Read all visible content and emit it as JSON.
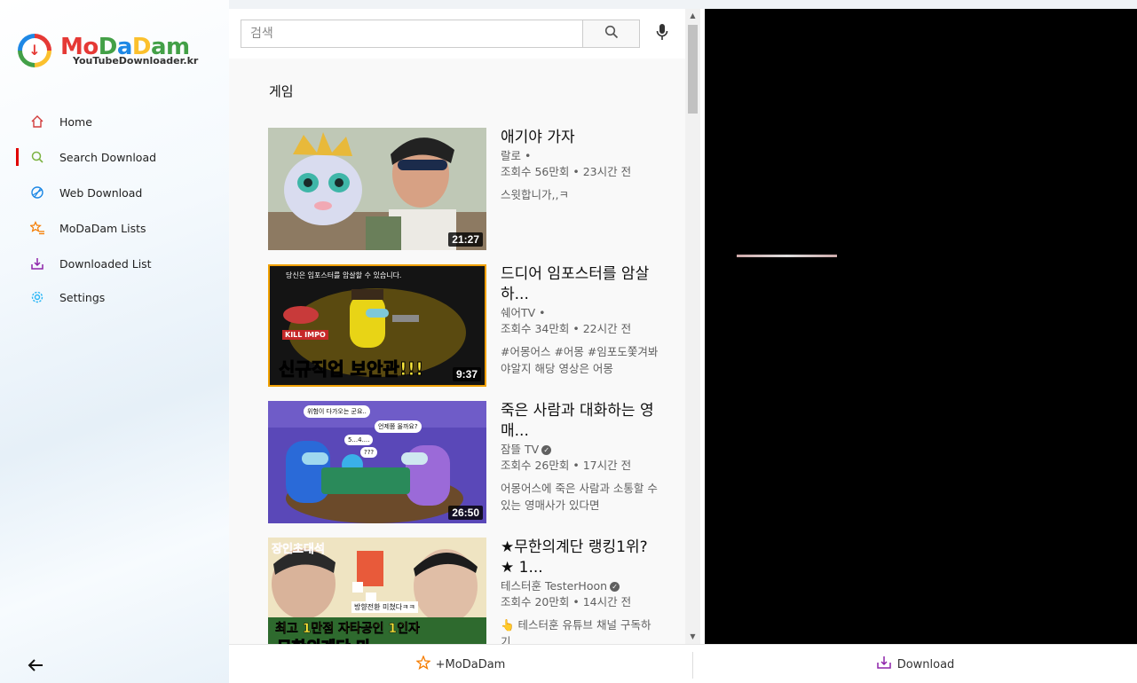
{
  "logo": {
    "title_parts": [
      "Mo",
      "D",
      "a",
      "D",
      "am"
    ],
    "subtitle": "YouTubeDownloader.kr"
  },
  "sidebar": {
    "items": [
      {
        "label": "Home",
        "icon": "home-icon",
        "active": false
      },
      {
        "label": "Search Download",
        "icon": "search-icon",
        "active": true
      },
      {
        "label": "Web Download",
        "icon": "globe-icon",
        "active": false
      },
      {
        "label": "MoDaDam Lists",
        "icon": "star-list-icon",
        "active": false
      },
      {
        "label": "Downloaded List",
        "icon": "download-tray-icon",
        "active": false
      },
      {
        "label": "Settings",
        "icon": "gear-icon",
        "active": false
      }
    ]
  },
  "search": {
    "placeholder": "검색"
  },
  "section": {
    "title": "게임"
  },
  "videos": [
    {
      "title": "애기야 가자",
      "channel": "랄로 •",
      "meta": "조회수 56만회 • 23시간 전",
      "desc": "스윗합니가,,ㅋ",
      "duration": "21:27",
      "verified": false
    },
    {
      "title": "드디어 임포스터를 암살하...",
      "channel": "쉐어TV •",
      "meta": "조회수 34만회 • 22시간 전",
      "desc": "#어몽어스 #어몽 #임포도쫓겨봐야알지 해당 영상은 어몽",
      "duration": "9:37",
      "verified": false,
      "thumb_top_text": "당신은 임포스터를 암살할 수 있습니다.",
      "thumb_big_text": "신규직업 보안관!!!",
      "thumb_tag": "KILL IMPO"
    },
    {
      "title": "죽은 사람과 대화하는 영매...",
      "channel": "잠뜰 TV",
      "meta": "조회수 26만회 • 17시간 전",
      "desc": "어몽어스에 죽은 사람과 소통할 수 있는 영매사가 있다면",
      "duration": "26:50",
      "verified": true,
      "thumb_bubbles": [
        "위험이 다가오는 군요..",
        "언제쯤 올까요?",
        "5...4....",
        "???"
      ]
    },
    {
      "title": "★무한의계단 랭킹1위?★ 1...",
      "channel": "테스터훈 TesterHoon",
      "meta": "조회수 20만회 • 14시간 전",
      "desc": "👆 테스터훈 유튜브 채널 구독하기",
      "duration": "",
      "verified": true,
      "thumb_top_text": "장인초대석",
      "thumb_mid_text": "방향전환 미쳤다ㅋㅋ",
      "thumb_big_text": "최고 1만점 자타공인 1인자",
      "thumb_bottom_text": "무한의계단 마"
    }
  ],
  "bottom": {
    "add_label": "+MoDaDam",
    "download_label": "Download"
  }
}
